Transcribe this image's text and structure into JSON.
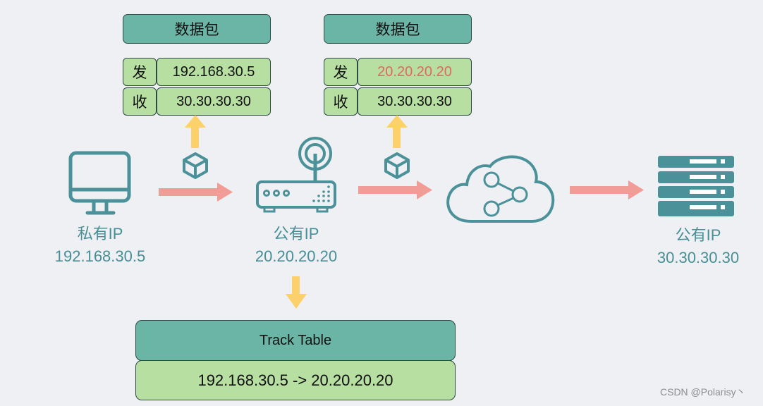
{
  "packets": [
    {
      "title": "数据包",
      "rows": [
        {
          "label": "发",
          "value": "192.168.30.5",
          "highlight": false
        },
        {
          "label": "收",
          "value": "30.30.30.30",
          "highlight": false
        }
      ]
    },
    {
      "title": "数据包",
      "rows": [
        {
          "label": "发",
          "value": "20.20.20.20",
          "highlight": true
        },
        {
          "label": "收",
          "value": "30.30.30.30",
          "highlight": false
        }
      ]
    }
  ],
  "nodes": {
    "computer": {
      "icon": "computer-icon",
      "type_label": "私有IP",
      "ip": "192.168.30.5"
    },
    "router": {
      "icon": "router-icon",
      "type_label": "公有IP",
      "ip": "20.20.20.20"
    },
    "cloud": {
      "icon": "cloud-network-icon"
    },
    "server": {
      "icon": "server-icon",
      "type_label": "公有IP",
      "ip": "30.30.30.30"
    }
  },
  "track_table": {
    "title": "Track Table",
    "entry": "192.168.30.5 -> 20.20.20.20"
  },
  "colors": {
    "teal": "#4b9199",
    "header_green": "#6bb5a6",
    "cell_green": "#b7dfa2",
    "flow_arrow": "#f19c96",
    "up_arrow": "#fcd06a",
    "highlight_red": "#e5675c",
    "background": "#eff0f3"
  },
  "watermark": "CSDN @Polarisy丶"
}
